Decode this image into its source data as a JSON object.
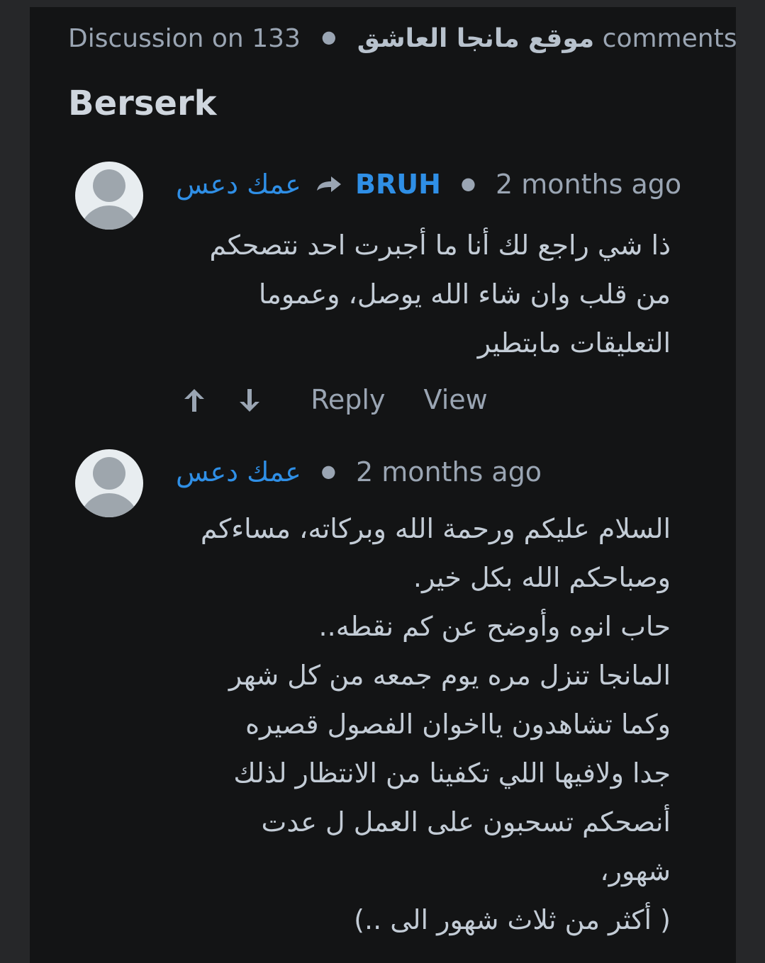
{
  "header": {
    "prefix": "Discussion on",
    "count": "133",
    "site_name": "موقع مانجا العاشق",
    "suffix": "comments",
    "title": "Berserk"
  },
  "comments": [
    {
      "author": "عمك دعس",
      "reply_to": "BRUH",
      "time": "2 months ago",
      "text": "ذا شي راجع لك أنا ما أجبرت احد نتصحكم\nمن قلب وان شاء الله يوصل، وعموما\nالتعليقات مابتطير",
      "actions": {
        "upvote_icon": "arrow-up-icon",
        "downvote_icon": "arrow-down-icon",
        "reply": "Reply",
        "view": "View"
      }
    },
    {
      "author": "عمك دعس",
      "time": "2 months ago",
      "text": "السلام عليكم ورحمة الله وبركاته، مساءكم\nوصباحكم الله بكل خير.\nحاب انوه وأوضح عن كم نقطه..\nالمانجا تنزل مره يوم جمعه من كل شهر\nوكما تشاهدون يااخوان الفصول قصيره\nجدا ولافيها اللي تكفينا من الانتظار لذلك\nأنصحكم تسحبون على العمل ل عدت\nشهور،\n( أكثر من ثلاث شهور الى ..)"
    }
  ],
  "colors": {
    "background": "#131415",
    "author_link": "#2f8fe6",
    "muted_text": "#9aa5b3",
    "body_text": "#c3ccd6"
  }
}
